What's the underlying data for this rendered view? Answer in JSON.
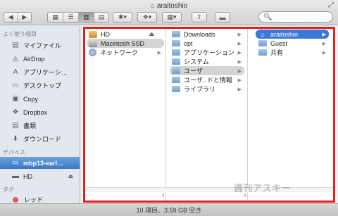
{
  "window": {
    "title": "araitoshio",
    "status": "10 項目、3.59 GB 空き"
  },
  "toolbar": {
    "back": "◀",
    "forward": "▶",
    "views": [
      "▦",
      "☰",
      "▥",
      "▤"
    ],
    "action": "✱▾",
    "dropbox": "❖▾",
    "arrange": "▦▾",
    "share": "⇪",
    "tag": "▬",
    "search_placeholder": "🔍"
  },
  "sidebar": {
    "favorites_heading": "よく使う項目",
    "favorites": [
      {
        "label": "マイファイル",
        "icon": "all-files-icon",
        "glyph": "▤"
      },
      {
        "label": "AirDrop",
        "icon": "airdrop-icon",
        "glyph": "◬"
      },
      {
        "label": "アプリケーシ…",
        "icon": "applications-icon",
        "glyph": "A"
      },
      {
        "label": "デスクトップ",
        "icon": "desktop-icon",
        "glyph": "▭"
      },
      {
        "label": "Copy",
        "icon": "folder-icon",
        "glyph": "▣"
      },
      {
        "label": "Dropbox",
        "icon": "dropbox-icon",
        "glyph": "❖"
      },
      {
        "label": "書類",
        "icon": "documents-icon",
        "glyph": "▤"
      },
      {
        "label": "ダウンロード",
        "icon": "downloads-icon",
        "glyph": "⬇"
      }
    ],
    "devices_heading": "デバイス",
    "devices": [
      {
        "label": "mbp13-earl…",
        "icon": "laptop-icon",
        "glyph": "▭",
        "selected": true,
        "eject": ""
      },
      {
        "label": "HD",
        "icon": "disk-icon",
        "glyph": "▬",
        "selected": false,
        "eject": "⏏"
      }
    ],
    "tags_heading": "タグ",
    "tags": [
      {
        "label": "レッド",
        "color": "#e45b5b"
      }
    ]
  },
  "columns": {
    "col1": [
      {
        "label": "HD",
        "kind": "disk",
        "eject": "⏏"
      },
      {
        "label": "Macintosh SSD",
        "kind": "disk",
        "selected": "gray"
      },
      {
        "label": "ネットワーク",
        "kind": "network",
        "arrow": true
      }
    ],
    "col2": [
      {
        "label": "Downloads",
        "arrow": true
      },
      {
        "label": "opt",
        "arrow": true
      },
      {
        "label": "アプリケーション",
        "arrow": true
      },
      {
        "label": "システム",
        "arrow": true
      },
      {
        "label": "ユーザ",
        "arrow": true,
        "selected": "gray"
      },
      {
        "label": "ユーザ‥ドと情報",
        "arrow": true
      },
      {
        "label": "ライブラリ",
        "arrow": true
      }
    ],
    "col3": [
      {
        "label": "araitoshio",
        "kind": "home",
        "arrow": true,
        "selected": "blue"
      },
      {
        "label": "Guest",
        "arrow": true
      },
      {
        "label": "共有",
        "arrow": true
      }
    ],
    "grip": "Ⅱ"
  },
  "watermark": "週刊アスキー",
  "colors": {
    "highlight_frame": "#e41f1f",
    "selection_blue": "#3b78d8",
    "tag_red": "#e45b5b"
  }
}
